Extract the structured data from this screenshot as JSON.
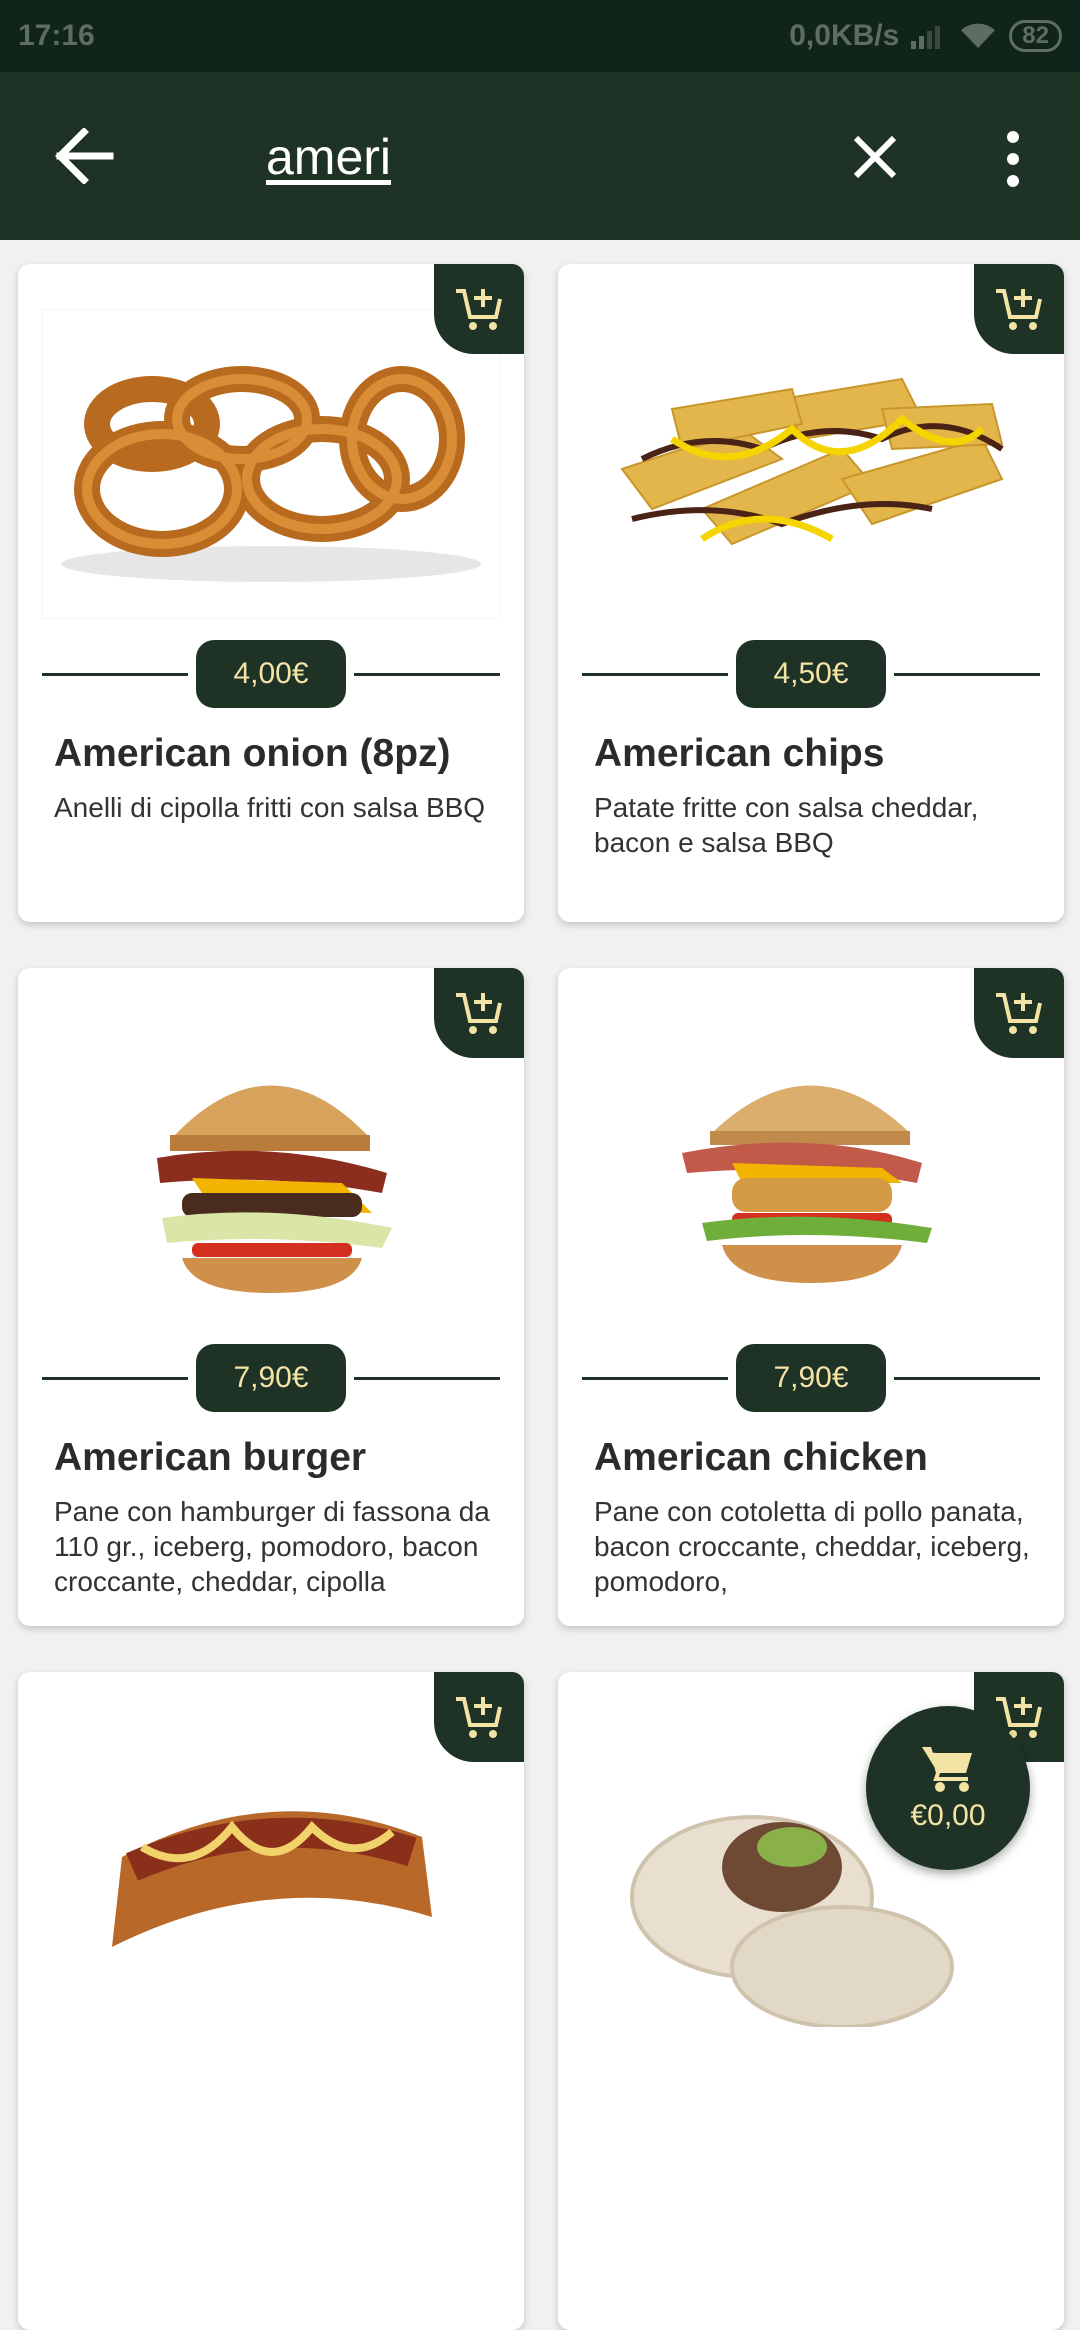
{
  "status_bar": {
    "time": "17:16",
    "net_speed": "0,0KB/s",
    "battery": "82"
  },
  "app_bar": {
    "search_value": "ameri"
  },
  "products": [
    {
      "name": "American onion (8pz)",
      "price": "4,00€",
      "description": "Anelli di cipolla fritti con salsa BBQ",
      "image": "onion-rings"
    },
    {
      "name": "American chips",
      "price": "4,50€",
      "description": "Patate fritte con salsa cheddar, bacon e salsa BBQ",
      "image": "potato-wedges"
    },
    {
      "name": "American burger",
      "price": "7,90€",
      "description": "Pane con hamburger di fassona da 110 gr., iceberg, pomodoro, bacon croccante, cheddar, cipolla",
      "image": "burger"
    },
    {
      "name": "American chicken",
      "price": "7,90€",
      "description": "Pane con cotoletta di pollo panata, bacon croccante, cheddar, iceberg, pomodoro,",
      "image": "chicken-burger"
    },
    {
      "name": "",
      "price": "",
      "description": "",
      "image": "hot-dog"
    },
    {
      "name": "",
      "price": "",
      "description": "",
      "image": "wrap"
    }
  ],
  "cart": {
    "total": "€0,00"
  },
  "colors": {
    "primary": "#1e3326",
    "accent": "#f3e3a4",
    "status_bar": "#11241a"
  }
}
